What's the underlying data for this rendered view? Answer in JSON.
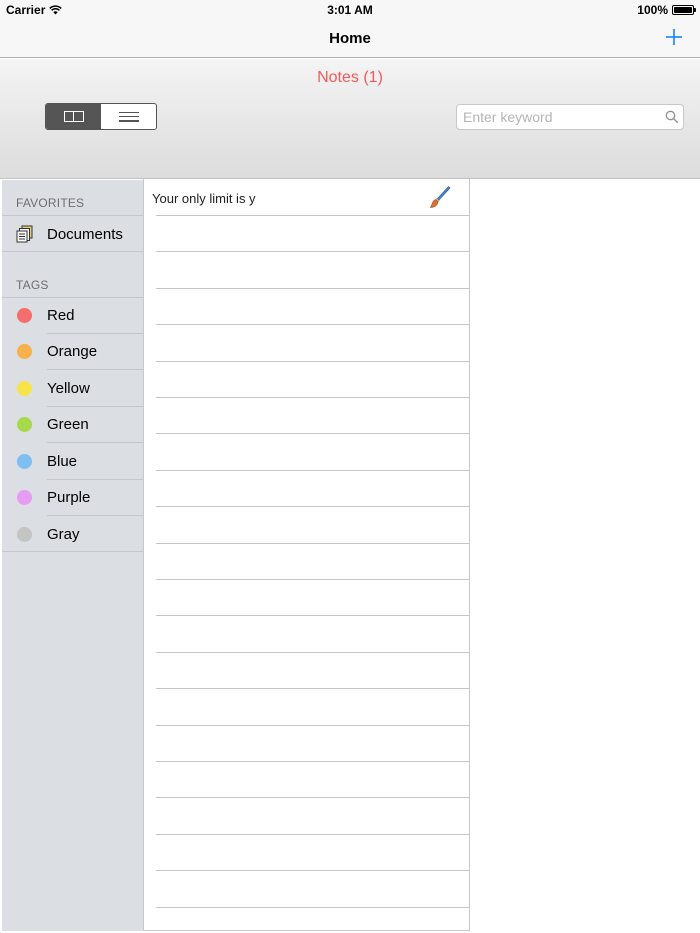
{
  "status_bar": {
    "carrier": "Carrier",
    "time": "3:01 AM",
    "battery": "100%"
  },
  "nav": {
    "title": "Home",
    "add_icon": "plus-icon"
  },
  "toolbar": {
    "notes_count": "Notes (1)",
    "view_modes": [
      "grid",
      "list"
    ],
    "active_view": "grid",
    "search": {
      "placeholder": "Enter keyword",
      "value": ""
    }
  },
  "sidebar": {
    "favorites_header": "FAVORITES",
    "favorites": [
      {
        "label": "Documents",
        "icon": "documents-icon"
      }
    ],
    "tags_header": "TAGS",
    "tags": [
      {
        "label": "Red",
        "color": "#f76c6c"
      },
      {
        "label": "Orange",
        "color": "#f8b04a"
      },
      {
        "label": "Yellow",
        "color": "#f6e449"
      },
      {
        "label": "Green",
        "color": "#a8d94a"
      },
      {
        "label": "Blue",
        "color": "#7dbff2"
      },
      {
        "label": "Purple",
        "color": "#e59cf2"
      },
      {
        "label": "Gray",
        "color": "#c4c4c4"
      }
    ]
  },
  "notes": [
    {
      "text": "Your only limit is y",
      "icon": "paintbrush-icon"
    }
  ],
  "colors": {
    "accent": "#1a82fb",
    "notes_count": "#f45a5a",
    "sidebar_bg": "#dbdee3"
  }
}
